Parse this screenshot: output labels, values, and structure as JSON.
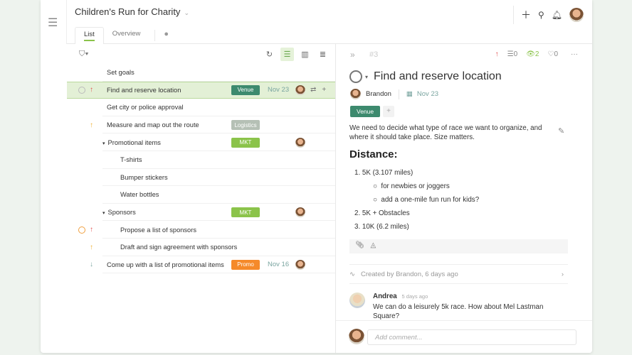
{
  "header": {
    "project_title": "Children's Run for Charity",
    "tabs": [
      "List",
      "Overview"
    ]
  },
  "list": {
    "rows": [
      {
        "name": "Set goals",
        "indent": 0
      },
      {
        "name": "Find and reserve location",
        "indent": 0,
        "priority": "up",
        "priority_color": "#e05050",
        "tag": "Venue",
        "tag_color": "#3d8a6e",
        "date": "Nov 23",
        "selected": true,
        "checkbox": true
      },
      {
        "name": "Get city or police approval",
        "indent": 0
      },
      {
        "name": "Measure and map out the route",
        "indent": 0,
        "priority": "up",
        "priority_color": "#f0b030",
        "tag": "Logistics",
        "tag_color": "#b5c0b5"
      },
      {
        "name": "Promotional items",
        "indent": 0,
        "group": true,
        "tag": "MKT",
        "tag_color": "#8bc34a",
        "avatar": true
      },
      {
        "name": "T-shirts",
        "indent": 1
      },
      {
        "name": "Bumper stickers",
        "indent": 1
      },
      {
        "name": "Water bottles",
        "indent": 1
      },
      {
        "name": "Sponsors",
        "indent": 0,
        "group": true,
        "tag": "MKT",
        "tag_color": "#8bc34a",
        "avatar": true
      },
      {
        "name": "Propose a list of sponsors",
        "indent": 1,
        "priority": "up",
        "priority_color": "#e05050",
        "checkbox": true,
        "checkbox_orange": true
      },
      {
        "name": "Draft and sign agreement with sponsors",
        "indent": 1,
        "priority": "up",
        "priority_color": "#f0b030"
      },
      {
        "name": "Come up with a list of promotional items",
        "indent": 0,
        "priority": "down",
        "priority_color": "#7aa5a0",
        "tag": "Promo",
        "tag_color": "#f58a2a",
        "date": "Nov 16",
        "avatar": true
      }
    ]
  },
  "detail": {
    "task_number": "#3",
    "subtasks": "0",
    "watchers": "2",
    "likes": "0",
    "title": "Find and reserve location",
    "assignee": "Brandon",
    "due": "Nov 23",
    "tag": "Venue",
    "description": "We need to decide what type of race we want to organize, and where it should take place. Size matters.",
    "heading": "Distance:",
    "items": [
      {
        "text": "1. 5K (3.107 miles)",
        "sub": [
          "for newbies or joggers",
          "add a one-mile fun run for kids?"
        ]
      },
      {
        "text": "2. 5K + Obstacles",
        "sub": []
      },
      {
        "text": "3. 10K (6.2 miles)",
        "sub": []
      }
    ],
    "activity": "Created by Brandon, 6 days ago",
    "comment": {
      "author": "Andrea",
      "time": "5 days ago",
      "text": "We can do a leisurely 5k race. How about Mel Lastman Square?"
    },
    "comment_placeholder": "Add comment..."
  }
}
